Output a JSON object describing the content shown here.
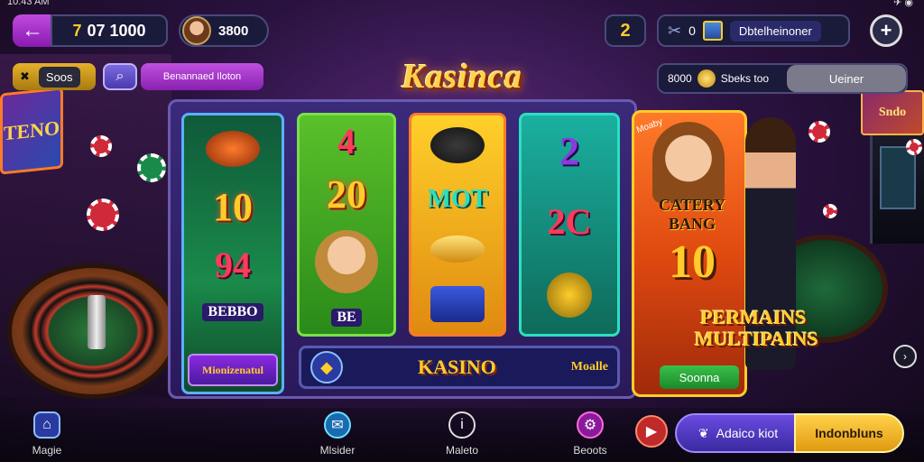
{
  "status_bar": {
    "left": "10:43 AM"
  },
  "header": {
    "coins_accent": "7",
    "coins_value": "07 1000",
    "profile_value": "3800",
    "gift_label": "2",
    "tools_count": "0",
    "tools_label": "Dbtelheinoner"
  },
  "subheader": {
    "left_button_label": "Soos",
    "promo_label": "Benannaed Iloton",
    "logo_text": "Kasinca",
    "right_coins": "8000",
    "right_text": "Sbeks too",
    "right_button_label": "Ueiner"
  },
  "bg_sign_text": "TENO",
  "bg_right_sign_text": "Sndo",
  "reels": {
    "reel1": {
      "top": "",
      "num": "10",
      "mid": "94",
      "word": "BEBBO",
      "footer": "Mionizenatul"
    },
    "reel2": {
      "top": "4",
      "mid": "20",
      "bottom": "BE"
    },
    "reel3": {
      "top": "",
      "mid": "MOT",
      "bottom": ""
    },
    "reel4": {
      "top": "2",
      "mid": "2C",
      "bottom": ""
    },
    "footer_mid": "KASINO",
    "footer_end": "Moalle"
  },
  "card": {
    "badge": "Moaby",
    "title": "CATERY BANG",
    "number": "10",
    "button_label": "Soonna"
  },
  "promo_text": {
    "line1": "PERMAINS",
    "line2": "MULTIPAINS"
  },
  "bottom_nav": [
    {
      "label": "Magie",
      "icon": "home-icon"
    },
    {
      "label": "Mlsider",
      "icon": "mail-icon"
    },
    {
      "label": "Maleto",
      "icon": "info-icon"
    },
    {
      "label": "Beoots",
      "icon": "gear-icon"
    }
  ],
  "actions": {
    "primary_label": "Adaico kiot",
    "secondary_label": "Indonbluns"
  }
}
